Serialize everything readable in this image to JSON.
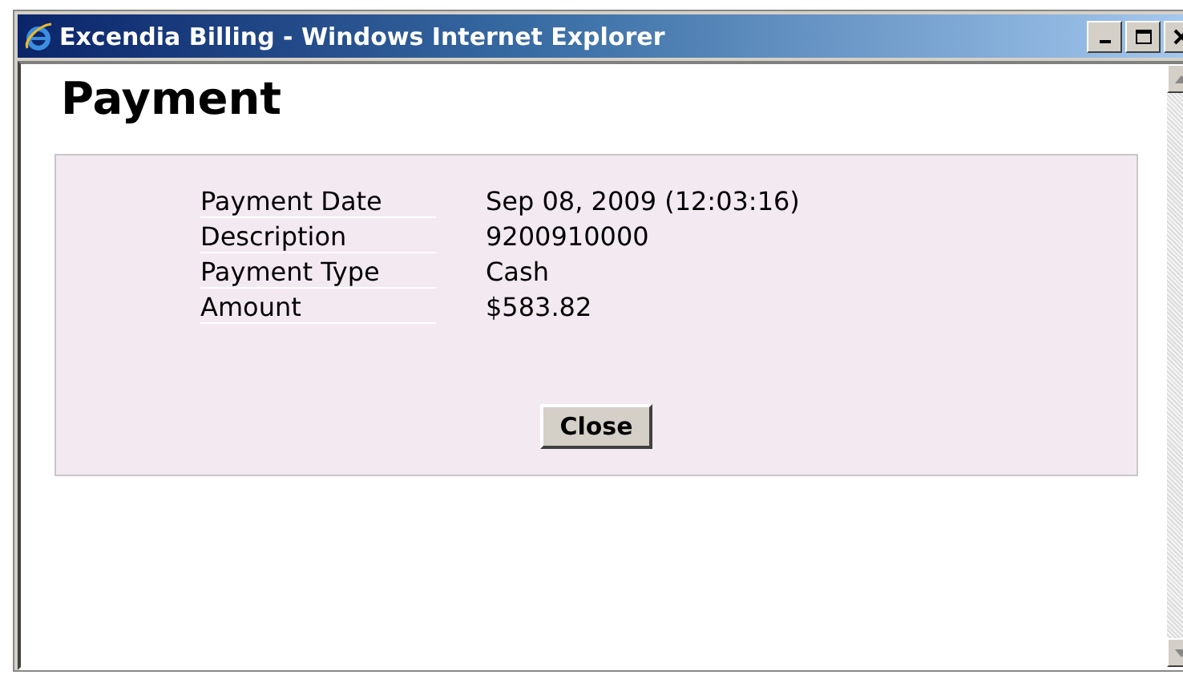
{
  "window": {
    "title": "Excendia Billing - Windows Internet Explorer"
  },
  "page": {
    "heading": "Payment"
  },
  "details": [
    {
      "label": "Payment Date",
      "value": "Sep 08, 2009 (12:03:16)"
    },
    {
      "label": "Description",
      "value": "9200910000"
    },
    {
      "label": "Payment Type",
      "value": "Cash"
    },
    {
      "label": "Amount",
      "value": "$583.82"
    }
  ],
  "buttons": [
    "Close"
  ]
}
